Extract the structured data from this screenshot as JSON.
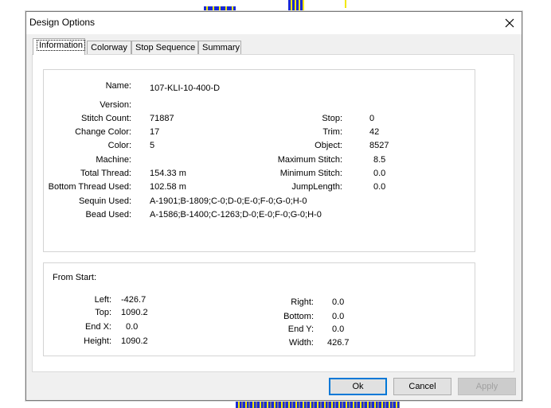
{
  "dialog": {
    "title": "Design Options",
    "close_glyph": "×"
  },
  "tabs": [
    {
      "label": "Information",
      "active": true
    },
    {
      "label": "Colorway",
      "active": false
    },
    {
      "label": "Stop Sequence",
      "active": false
    },
    {
      "label": "Summary",
      "active": false
    }
  ],
  "info": {
    "name": {
      "label": "Name:",
      "value": "107-KLI-10-400-DH"
    },
    "version": {
      "label": "Version:",
      "value": ""
    },
    "stitch_count": {
      "label": "Stitch Count:",
      "value": "71887"
    },
    "change_color": {
      "label": "Change Color:",
      "value": "17"
    },
    "color": {
      "label": "Color:",
      "value": "5"
    },
    "machine": {
      "label": "Machine:",
      "value": ""
    },
    "total_thread": {
      "label": "Total Thread:",
      "value": "154.33 m"
    },
    "bottom_thread": {
      "label": "Bottom Thread Used:",
      "value": "102.58 m"
    },
    "sequin_used": {
      "label": "Sequin Used:",
      "value": "A-1901;B-1809;C-0;D-0;E-0;F-0;G-0;H-0"
    },
    "bead_used": {
      "label": "Bead Used:",
      "value": "A-1586;B-1400;C-1263;D-0;E-0;F-0;G-0;H-0"
    },
    "stop": {
      "label": "Stop:",
      "value": "0"
    },
    "trim": {
      "label": "Trim:",
      "value": "42"
    },
    "object": {
      "label": "Object:",
      "value": "8527"
    },
    "max_stitch": {
      "label": "Maximum Stitch:",
      "value": "8.5"
    },
    "min_stitch": {
      "label": "Minimum Stitch:",
      "value": "0.0"
    },
    "jump_length": {
      "label": "JumpLength:",
      "value": "0.0"
    }
  },
  "from_start": {
    "heading": "From Start:",
    "left": {
      "label": "Left:",
      "value": "-426.7"
    },
    "top": {
      "label": "Top:",
      "value": "1090.2"
    },
    "end_x": {
      "label": "End X:",
      "value": "0.0"
    },
    "height": {
      "label": "Height:",
      "value": "1090.2"
    },
    "right": {
      "label": "Right:",
      "value": "0.0"
    },
    "bottom": {
      "label": "Bottom:",
      "value": "0.0"
    },
    "end_y": {
      "label": "End Y:",
      "value": "0.0"
    },
    "width": {
      "label": "Width:",
      "value": "426.7"
    }
  },
  "buttons": {
    "ok": "Ok",
    "cancel": "Cancel",
    "apply": "Apply"
  }
}
